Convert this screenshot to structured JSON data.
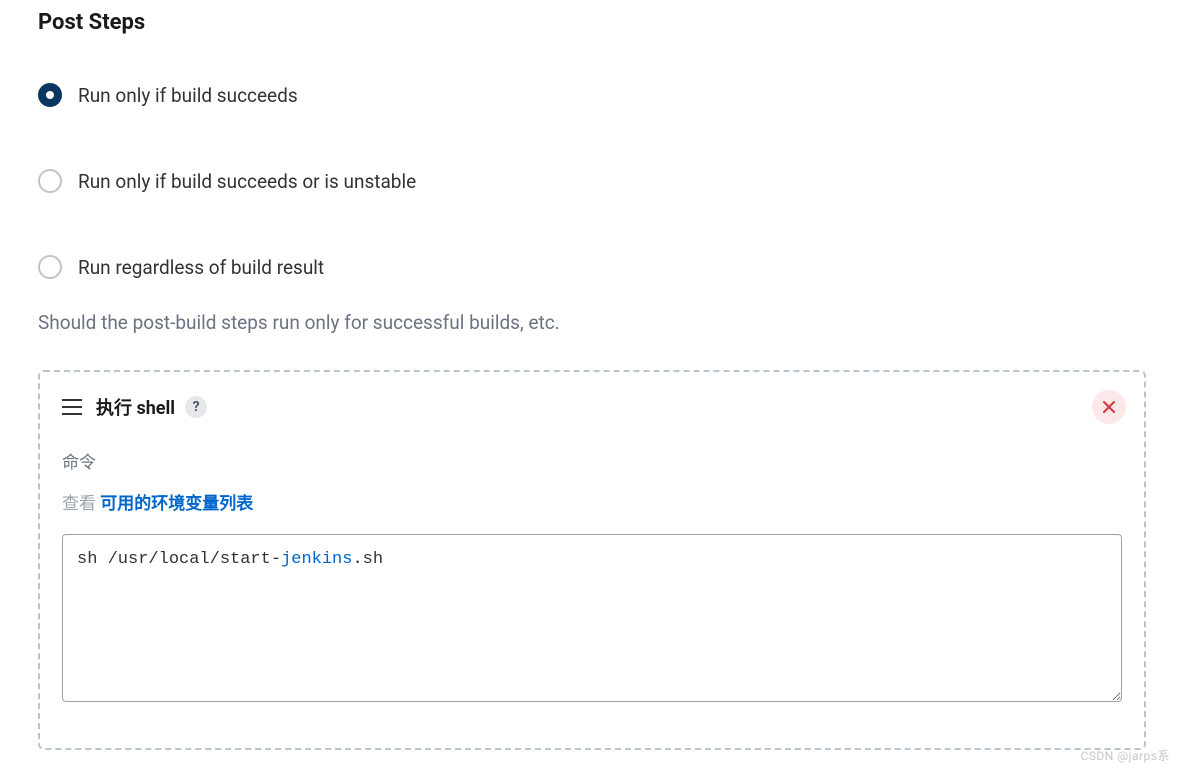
{
  "section": {
    "title": "Post Steps",
    "helpText": "Should the post-build steps run only for successful builds, etc."
  },
  "radios": {
    "opt1": "Run only if build succeeds",
    "opt2": "Run only if build succeeds or is unstable",
    "opt3": "Run regardless of build result",
    "selected": "opt1"
  },
  "step": {
    "title": "执行 shell",
    "helpBadge": "?",
    "commandLabel": "命令",
    "linkPrefix": "查看 ",
    "linkText": "可用的环境变量列表",
    "commandValue": "sh /usr/local/start-jenkins.sh"
  },
  "watermark": "CSDN @jarps系"
}
